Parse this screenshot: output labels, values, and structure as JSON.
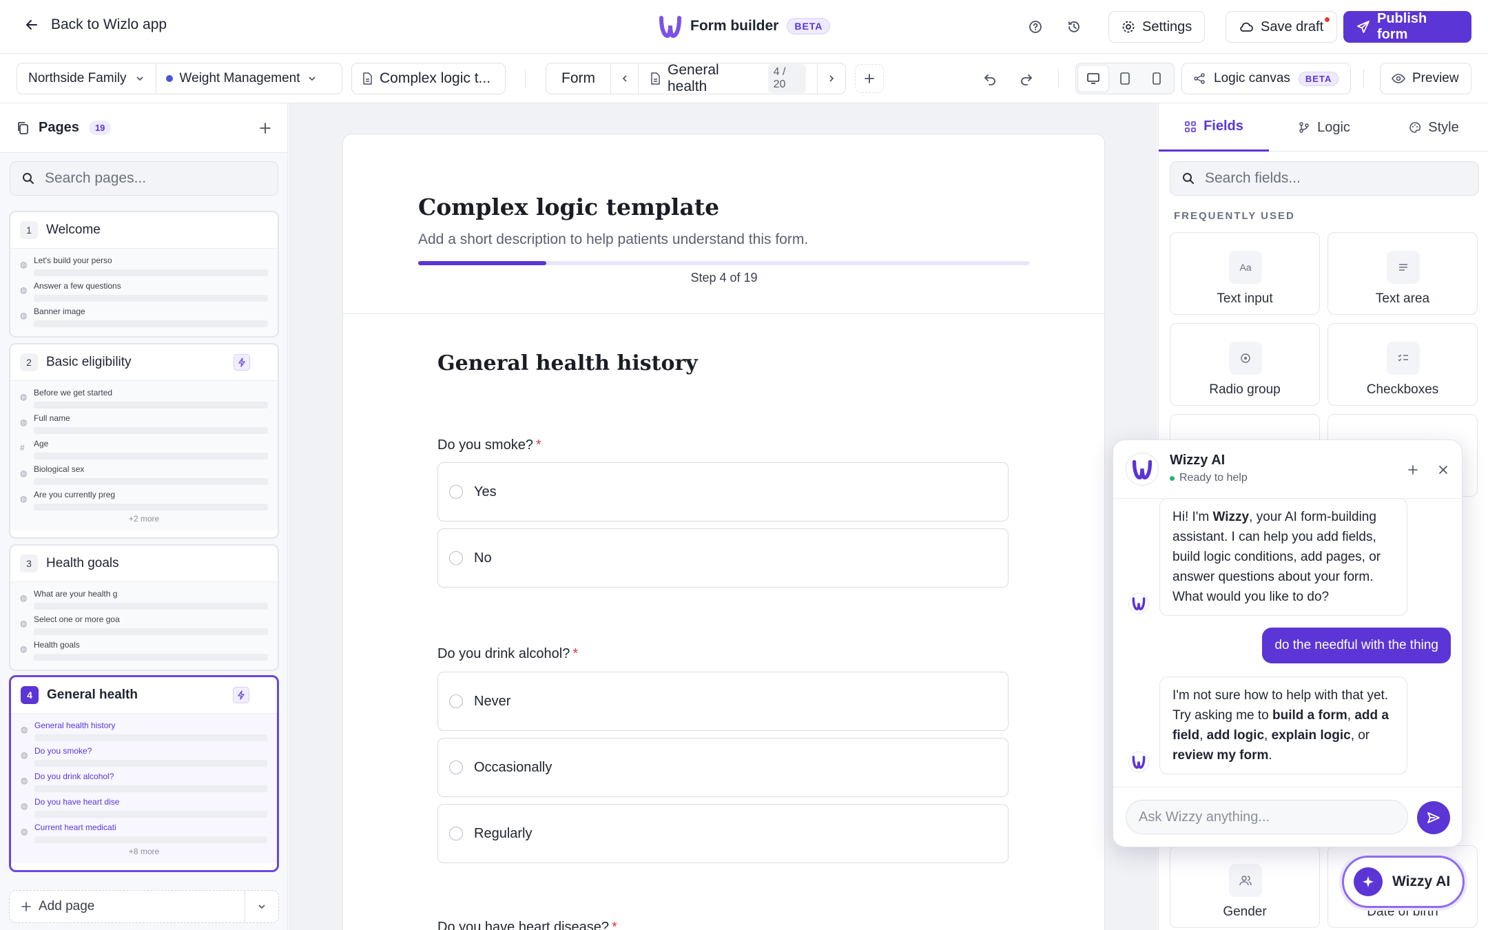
{
  "header": {
    "back_label": "Back to Wizlo app",
    "title": "Form builder",
    "badge": "BETA",
    "settings_label": "Settings",
    "save_label": "Save draft",
    "publish_label": "Publish form"
  },
  "toolbar": {
    "workspace": "Northside Family",
    "program": "Weight Management",
    "form_name": "Complex logic t...",
    "view_label": "Form",
    "current_page": "General health",
    "page_counter": "4 / 20",
    "logic_canvas_label": "Logic canvas",
    "logic_canvas_badge": "BETA",
    "preview_label": "Preview"
  },
  "sidebar": {
    "title": "Pages",
    "count": "19",
    "search_placeholder": "Search pages...",
    "pages": [
      {
        "num": "1",
        "title": "Welcome",
        "rows": [
          "Let's build your perso",
          "Answer a few questions",
          "Banner image"
        ]
      },
      {
        "num": "2",
        "title": "Basic eligibility",
        "rows": [
          "Before we get started",
          "Full name",
          "Age",
          "Biological sex",
          "Are you currently preg"
        ],
        "more": "+2 more"
      },
      {
        "num": "3",
        "title": "Health goals",
        "rows": [
          "What are your health g",
          "Select one or more goa",
          "Health goals"
        ]
      },
      {
        "num": "4",
        "title": "General health",
        "rows": [
          "General health history",
          "Do you smoke?",
          "Do you drink alcohol?",
          "Do you have heart dise",
          "Current heart medicati"
        ],
        "more": "+8 more"
      }
    ],
    "add_page_label": "Add page"
  },
  "form": {
    "title": "Complex logic template",
    "description": "Add a short description to help patients understand this form.",
    "progress_fraction": 0.21,
    "step_text": "Step 4 of 19",
    "section_title": "General health history",
    "questions": [
      {
        "label": "Do you smoke?",
        "options": [
          "Yes",
          "No"
        ]
      },
      {
        "label": "Do you drink alcohol?",
        "options": [
          "Never",
          "Occasionally",
          "Regularly"
        ]
      },
      {
        "label": "Do you have heart disease?"
      }
    ]
  },
  "right_panel": {
    "tabs": [
      "Fields",
      "Logic",
      "Style"
    ],
    "search_placeholder": "Search fields...",
    "section_label": "FREQUENTLY USED",
    "fields": [
      "Text input",
      "Text area",
      "Radio group",
      "Checkboxes",
      "Gender",
      "Date of birth"
    ]
  },
  "chat": {
    "name": "Wizzy AI",
    "status": "Ready to help",
    "msg1_pre": "Hi! I'm ",
    "msg1_bold": "Wizzy",
    "msg1_post": ", your AI form-building assistant. I can help you add fields, build logic conditions, add pages, or answer questions about your form. What would you like to do?",
    "user_msg": "do the needful with the thing",
    "msg2_pre": "I'm not sure how to help with that yet. Try asking me to ",
    "msg2_k1": "build a form",
    "msg2_k2": "add a field",
    "msg2_k3": "add logic",
    "msg2_k4": "explain logic",
    "msg2_k5": "review my form",
    "sep_comma": ", ",
    "sep_or": ", or ",
    "period": ".",
    "input_placeholder": "Ask Wizzy anything...",
    "fab_label": "Wizzy AI"
  },
  "colors": {
    "accent": "#5b35d5",
    "required": "#d93a3a"
  }
}
